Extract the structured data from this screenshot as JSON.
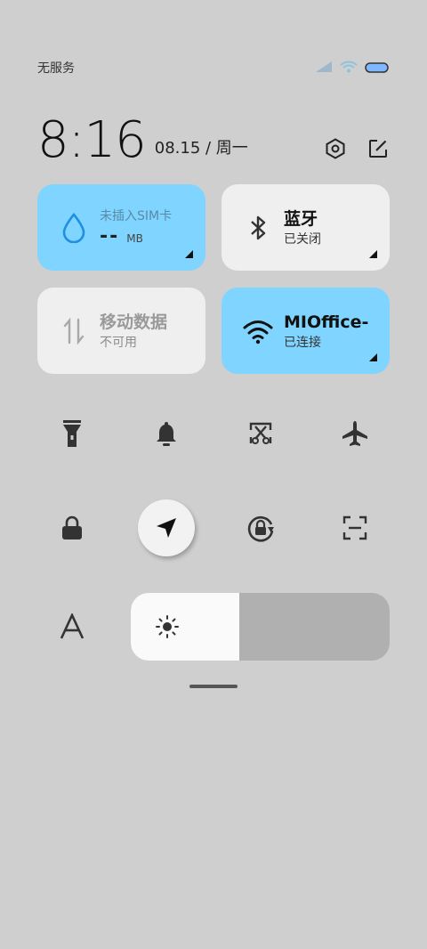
{
  "status_bar": {
    "carrier": "无服务",
    "icons": [
      "signal-icon",
      "wifi-icon",
      "battery-icon"
    ]
  },
  "header": {
    "time": "8:16",
    "date": "08.15 / 周一",
    "actions": [
      "settings-icon",
      "edit-icon"
    ]
  },
  "tiles": {
    "sim": {
      "label": "未插入SIM卡",
      "value": "--",
      "unit": "MB",
      "icon": "water-drop-icon"
    },
    "bluetooth": {
      "title": "蓝牙",
      "status": "已关闭",
      "icon": "bluetooth-icon"
    },
    "mobile_data": {
      "title": "移动数据",
      "status": "不可用",
      "icon": "mobile-data-icon"
    },
    "wifi": {
      "title": "MIOffice-",
      "status": "已连接",
      "icon": "wifi-icon"
    }
  },
  "toggles_row1": [
    "flashlight-icon",
    "bell-icon",
    "screenshot-icon",
    "airplane-icon"
  ],
  "toggles_row2": [
    "lock-icon",
    "location-icon",
    "rotation-lock-icon",
    "scan-icon"
  ],
  "brightness": {
    "level_percent": 42,
    "icon": "sun-icon",
    "font_icon": "font-size-icon"
  },
  "colors": {
    "accent": "#7fd5ff",
    "background": "#cfcfcf",
    "tile_gray": "#efefef"
  }
}
